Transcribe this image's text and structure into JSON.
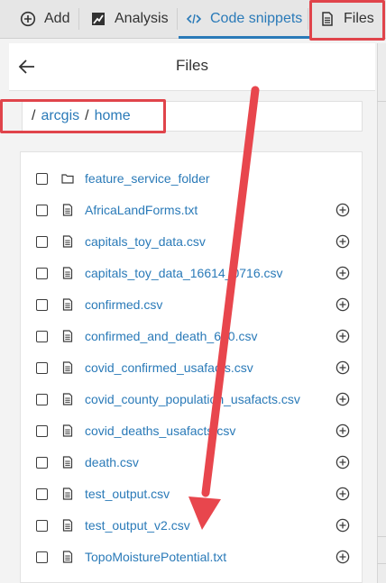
{
  "tabs": [
    {
      "label": "Add",
      "icon": "plus-circle-icon"
    },
    {
      "label": "Analysis",
      "icon": "analysis-icon"
    },
    {
      "label": "Code snippets",
      "icon": "code-icon",
      "active": true
    },
    {
      "label": "Files",
      "icon": "file-icon"
    }
  ],
  "panel": {
    "title": "Files",
    "back_icon": "arrow-left-icon"
  },
  "breadcrumb": {
    "parts": [
      "arcgis",
      "home"
    ]
  },
  "files": [
    {
      "name": "feature_service_folder",
      "type": "folder",
      "addable": false
    },
    {
      "name": "AfricaLandForms.txt",
      "type": "file",
      "addable": true
    },
    {
      "name": "capitals_toy_data.csv",
      "type": "file",
      "addable": true
    },
    {
      "name": "capitals_toy_data_16614_0716.csv",
      "type": "file",
      "addable": true
    },
    {
      "name": "confirmed.csv",
      "type": "file",
      "addable": true
    },
    {
      "name": "confirmed_and_death_630.csv",
      "type": "file",
      "addable": true
    },
    {
      "name": "covid_confirmed_usafacts.csv",
      "type": "file",
      "addable": true
    },
    {
      "name": "covid_county_population_usafacts.csv",
      "type": "file",
      "addable": true
    },
    {
      "name": "covid_deaths_usafacts.csv",
      "type": "file",
      "addable": true
    },
    {
      "name": "death.csv",
      "type": "file",
      "addable": true
    },
    {
      "name": "test_output.csv",
      "type": "file",
      "addable": true
    },
    {
      "name": "test_output_v2.csv",
      "type": "file",
      "addable": true
    },
    {
      "name": "TopoMoisturePotential.txt",
      "type": "file",
      "addable": true
    }
  ],
  "colors": {
    "accent": "#2a7ab8",
    "annotation": "#e0444b"
  }
}
